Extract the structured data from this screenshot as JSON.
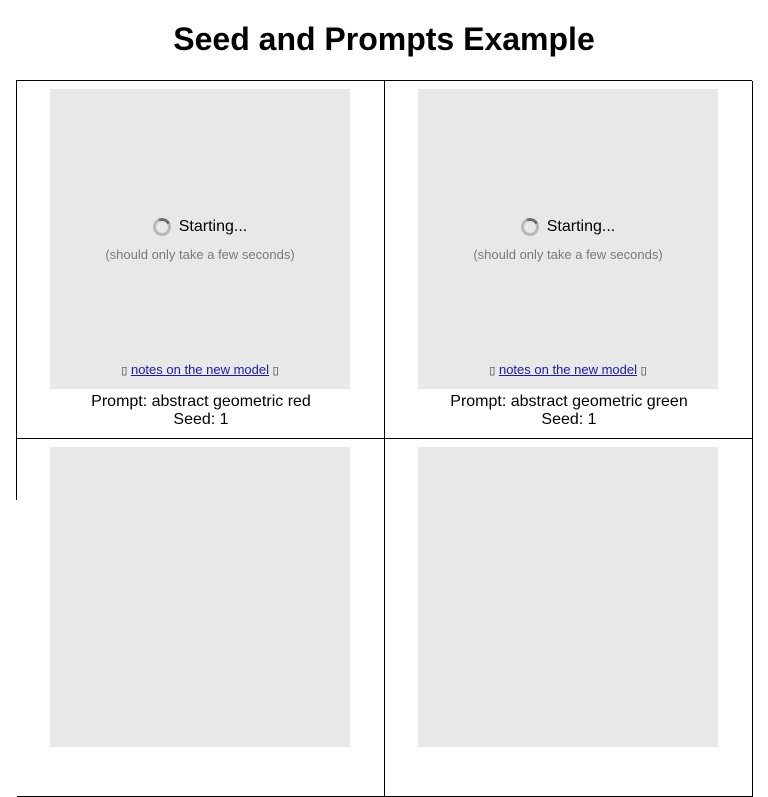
{
  "page": {
    "title": "Seed and Prompts Example"
  },
  "loader": {
    "status_text": "Starting...",
    "hint_text": "(should only take a few seconds)",
    "notes_link_text": "notes on the new model",
    "notes_prefix_glyph": "▯",
    "notes_suffix_glyph": "▯"
  },
  "cells": [
    {
      "prompt_label": "Prompt: abstract geometric red",
      "seed_label": "Seed: 1"
    },
    {
      "prompt_label": "Prompt: abstract geometric green",
      "seed_label": "Seed: 1"
    }
  ],
  "colors": {
    "frame_background": "#e8e8e8",
    "link": "#1a1aa6",
    "hint": "#7a7a7a"
  }
}
